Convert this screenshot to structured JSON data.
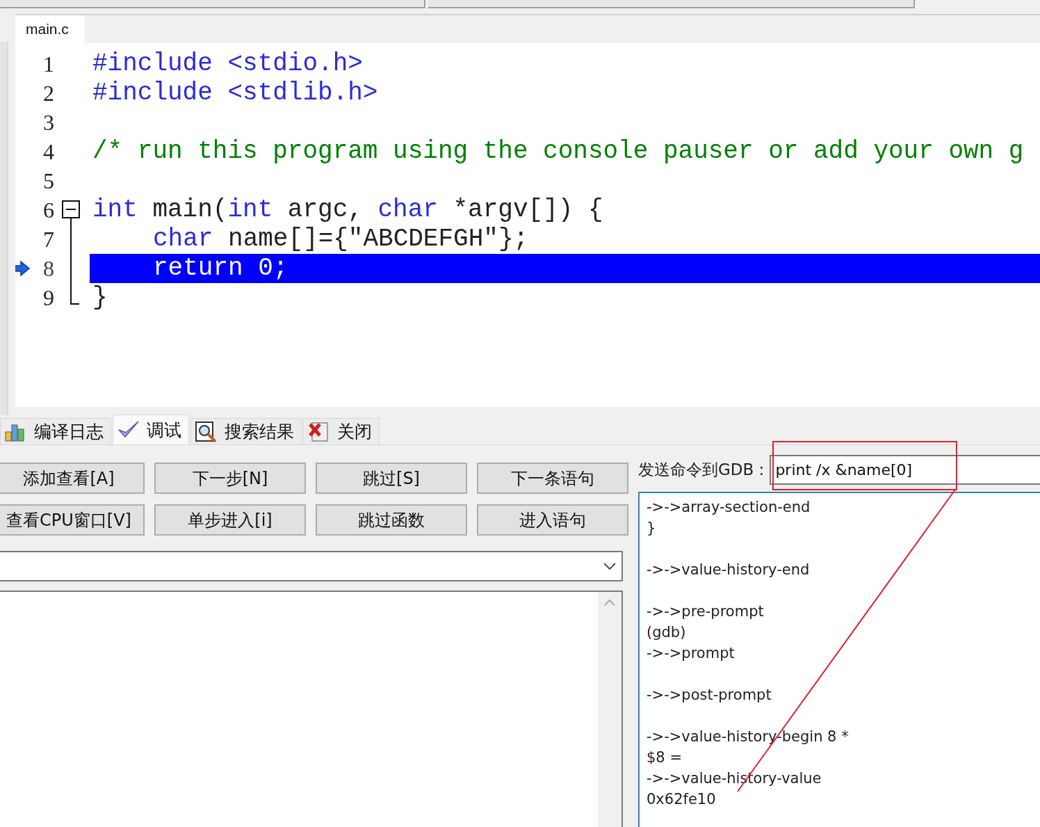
{
  "editor": {
    "tabs": [
      {
        "label": "main.c",
        "selected": true
      }
    ],
    "lines": [
      {
        "number": "1",
        "current": false,
        "kind": "plain",
        "indented": false,
        "tokens": [
          {
            "kind": "preproc",
            "text": "#include <stdio.h>"
          }
        ]
      },
      {
        "number": "2",
        "current": false,
        "kind": "plain",
        "indented": false,
        "tokens": [
          {
            "kind": "preproc",
            "text": "#include <stdlib.h>"
          }
        ]
      },
      {
        "number": "3",
        "current": false,
        "kind": "plain"
      },
      {
        "number": "4",
        "current": false,
        "kind": "plain",
        "indented": false,
        "tokens": [
          {
            "kind": "comment",
            "text": "/* run this program using the console pauser or add your own g"
          }
        ]
      },
      {
        "number": "5",
        "current": false,
        "kind": "plain"
      },
      {
        "number": "6",
        "current": false,
        "kind": "foldstart",
        "indented": false,
        "tokens": [
          {
            "kind": "keyword",
            "text": "int"
          },
          {
            "kind": "plain",
            "text": " main("
          },
          {
            "kind": "keyword",
            "text": "int"
          },
          {
            "kind": "plain",
            "text": " argc, "
          },
          {
            "kind": "keyword",
            "text": "char"
          },
          {
            "kind": "plain",
            "text": " *argv[]) {"
          }
        ]
      },
      {
        "number": "7",
        "current": false,
        "kind": "foldbody",
        "indented": true,
        "tokens": [
          {
            "kind": "keyword",
            "text": "char"
          },
          {
            "kind": "plain",
            "text": " name[]={\"ABCDEFGH\"};"
          }
        ]
      },
      {
        "number": "8",
        "current": true,
        "kind": "foldbody",
        "indented": true,
        "tokens": [
          {
            "kind": "keyword",
            "text": "return"
          },
          {
            "kind": "plain",
            "text": " 0;"
          }
        ]
      },
      {
        "number": "9",
        "current": false,
        "kind": "foldend",
        "indented": false,
        "tokens": [
          {
            "kind": "plain",
            "text": "}"
          }
        ]
      }
    ]
  },
  "bottom_tabs": [
    {
      "label": "编译日志",
      "selected": false
    },
    {
      "label": "调试",
      "selected": true
    },
    {
      "label": "搜索结果",
      "selected": false
    },
    {
      "label": "关闭",
      "selected": false
    }
  ],
  "debug_buttons": [
    "添加查看[A]",
    "下一步[N]",
    "跳过[S]",
    "下一条语句",
    "查看CPU窗口[V]",
    "单步进入[i]",
    "跳过函数",
    "进入语句"
  ],
  "gdb": {
    "label": "发送命令到GDB :",
    "command": "print /x &name[0]",
    "output": [
      {
        "text": "->->array-section-end",
        "spaced": false
      },
      {
        "text": "}",
        "spaced": false
      },
      {
        "text": "->->value-history-end",
        "spaced": true
      },
      {
        "text": "->->pre-prompt",
        "spaced": true
      },
      {
        "text": "(gdb)",
        "spaced": false
      },
      {
        "text": "->->prompt",
        "spaced": false
      },
      {
        "text": "->->post-prompt",
        "spaced": true
      },
      {
        "text": "->->value-history-begin 8 *",
        "spaced": true
      },
      {
        "text": "$8 =",
        "spaced": false
      },
      {
        "text": "->->value-history-value",
        "spaced": false
      },
      {
        "text": "0x62fe10",
        "spaced": false
      }
    ]
  }
}
